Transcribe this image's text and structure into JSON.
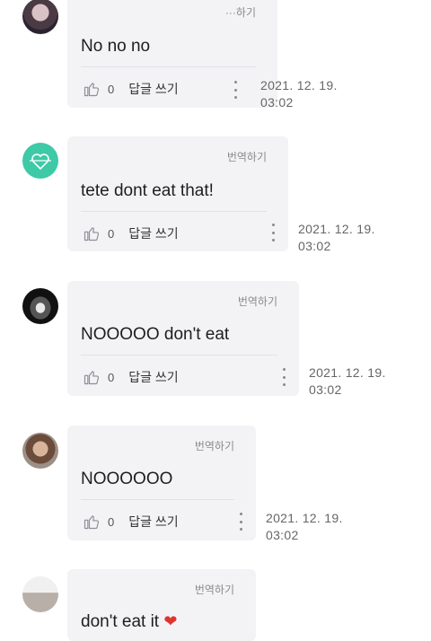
{
  "comments": [
    {
      "message": "No no no",
      "translate_label": "···하기",
      "likes": "0",
      "reply_label": "답글 쓰기",
      "date": "2021. 12. 19.",
      "time": "03:02"
    },
    {
      "message": "tete dont eat that!",
      "translate_label": "번역하기",
      "likes": "0",
      "reply_label": "답글 쓰기",
      "date": "2021. 12. 19.",
      "time": "03:02"
    },
    {
      "message": "NOOOOO don't eat",
      "translate_label": "번역하기",
      "likes": "0",
      "reply_label": "답글 쓰기",
      "date": "2021. 12. 19.",
      "time": "03:02"
    },
    {
      "message": "NOOOOOO",
      "translate_label": "번역하기",
      "likes": "0",
      "reply_label": "답글 쓰기",
      "date": "2021. 12. 19.",
      "time": "03:02"
    },
    {
      "message": "don't eat it",
      "translate_label": "번역하기"
    }
  ],
  "icons": {
    "like": "thumbs-up-icon",
    "more": "more-vertical-icon",
    "heart": "red-heart-emoji"
  },
  "colors": {
    "bubble": "#f3f3f6",
    "avatar_teal": "#3ec9a7",
    "heart": "#e0342f"
  }
}
